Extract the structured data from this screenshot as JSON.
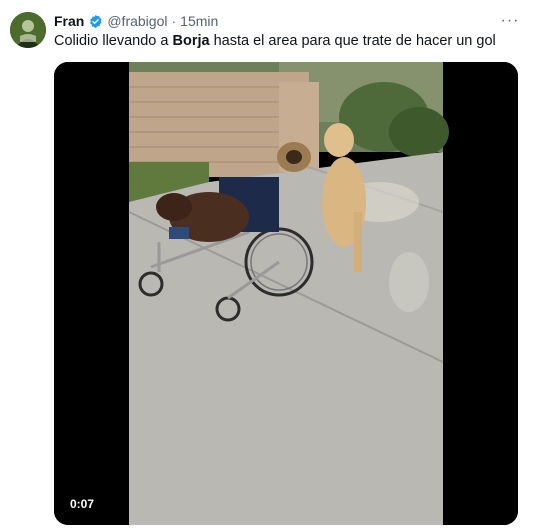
{
  "tweet": {
    "author_name": "Fran",
    "handle": "@frabigol",
    "separator": "·",
    "time": "15min",
    "more_label": "···",
    "text_before": "Colidio llevando a ",
    "text_bold": "Borja",
    "text_after": " hasta el area para que trate de hacer un gol",
    "video_duration": "0:07"
  },
  "colors": {
    "verified": "#1d9bf0",
    "muted": "#536471",
    "text": "#0f1419"
  },
  "icons": {
    "verified": "verified-badge-icon",
    "more": "more-options-icon"
  }
}
